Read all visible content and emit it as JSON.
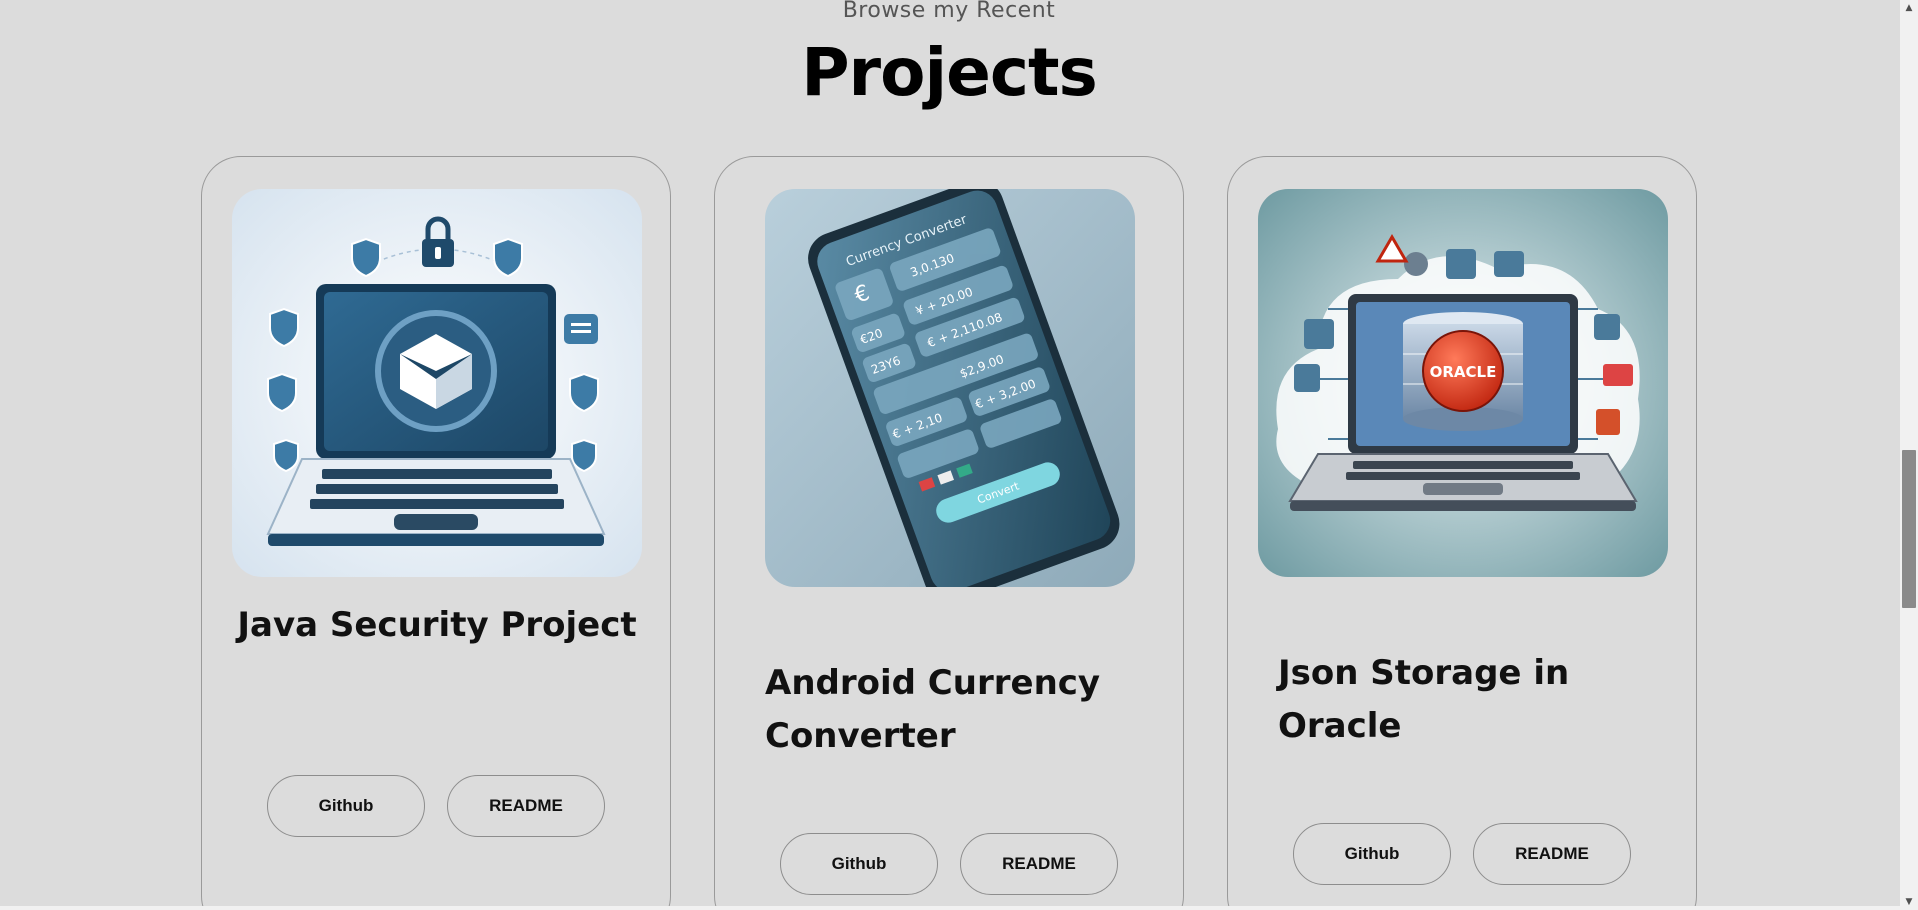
{
  "header": {
    "subtitle": "Browse my Recent",
    "title": "Projects"
  },
  "projects": [
    {
      "title": "Java Security Project",
      "image_icon": "laptop-security-image",
      "github_label": "Github",
      "readme_label": "README"
    },
    {
      "title": "Android Currency Converter",
      "image_icon": "phone-currency-image",
      "github_label": "Github",
      "readme_label": "README",
      "screen": {
        "app_name": "Currency Converter",
        "values": [
          "3,0.130",
          "€20",
          "¥ + 20.00",
          "23Y6",
          "€ + 2,110.08",
          "$2,9.00",
          "€ + 2,10",
          "€ + 3,2.00"
        ],
        "convert_label": "Convert"
      }
    },
    {
      "title": "Json Storage in Oracle",
      "image_icon": "laptop-oracle-image",
      "github_label": "Github",
      "readme_label": "README",
      "logo_text": "ORACLE"
    }
  ],
  "colors": {
    "background": "#dcdcdc",
    "card_border": "#9a9a9a",
    "scroll_thumb": "#8a8a8a"
  }
}
